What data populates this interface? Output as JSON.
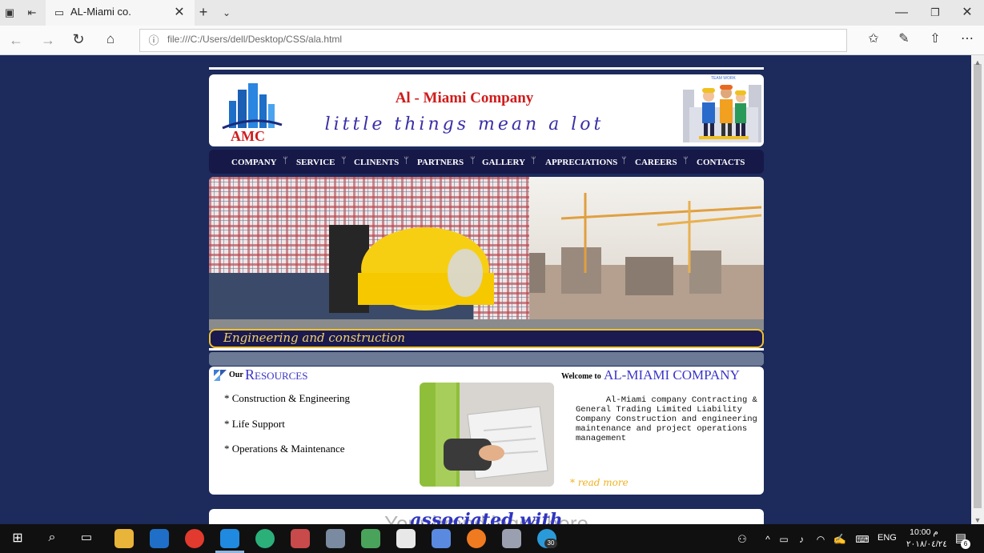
{
  "browser": {
    "tab_title": "AL-Miami co.",
    "url": "file:///C:/Users/dell/Desktop/CSS/ala.html"
  },
  "header": {
    "company_name": "Al - Miami Company",
    "tagline": "little things mean a lot",
    "logo_text": "AMC",
    "teamwork_text": "TEAM WORK"
  },
  "nav": {
    "items": [
      "COMPANY",
      "SERVICE",
      "CLINENTS",
      "PARTNERS",
      "GALLERY",
      "APPRECIATIONS",
      "CAREERS",
      "CONTACTS"
    ]
  },
  "banner": {
    "caption": "Engineering and construction"
  },
  "resources": {
    "our": "Our",
    "title": "Resources",
    "items": [
      "* Construction & Engineering",
      "* Life Support",
      "* Operations & Maintenance"
    ]
  },
  "welcome": {
    "small": "Welcome to",
    "big": "AL-MIAMI COMPANY",
    "description": "      Al-Miami company Contracting & General Trading Limited Liability Company Construction and engineering maintenance and project operations management",
    "read_more": "* read more"
  },
  "footer": {
    "associated": "associated with",
    "ghost_text": "Your brand logos here"
  },
  "taskbar": {
    "language": "ENG",
    "time": "10:00 م",
    "date": "٢٠١٨/٠٤/٢٤",
    "notification_count": "6",
    "telegram_badge": "30"
  }
}
